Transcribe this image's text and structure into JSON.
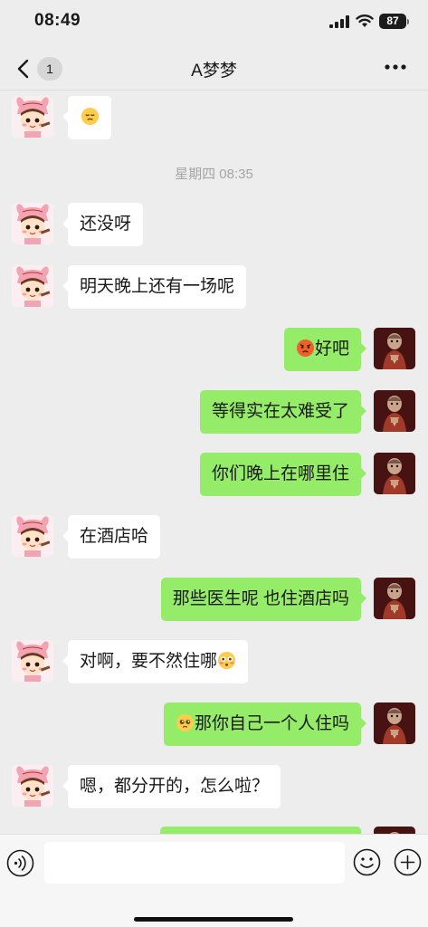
{
  "status_bar": {
    "time": "08:49",
    "battery": "87"
  },
  "nav": {
    "back_badge": "1",
    "title": "A梦梦"
  },
  "chat": {
    "timestamp": "星期四 08:35",
    "messages": [
      {
        "side": "left",
        "emoji_only": "sleepy-face-emoji"
      },
      {
        "side": "left",
        "text": "还没呀"
      },
      {
        "side": "left",
        "text": "明天晚上还有一场呢"
      },
      {
        "side": "right",
        "text": "好吧",
        "leading_emoji": "angry-face-emoji"
      },
      {
        "side": "right",
        "text": "等得实在太难受了"
      },
      {
        "side": "right",
        "text": "你们晚上在哪里住"
      },
      {
        "side": "left",
        "text": "在酒店哈"
      },
      {
        "side": "right",
        "text": "那些医生呢 也住酒店吗"
      },
      {
        "side": "left",
        "text": "对啊，要不然住哪",
        "trailing_emoji": "flushed-face-emoji"
      },
      {
        "side": "right",
        "text": "那你自己一个人住吗",
        "leading_emoji": "pleading-face-emoji"
      },
      {
        "side": "left",
        "text": "嗯，都分开的，怎么啦？"
      }
    ]
  },
  "colors": {
    "background": "#ededed",
    "bubble_right": "#95ec69",
    "bubble_left": "#ffffff",
    "timestamp": "#a5a5a5"
  },
  "icons": {
    "back": "chevron-left-icon",
    "more": "more-dots-icon",
    "voice": "voice-icon",
    "emoji": "emoji-icon",
    "plus": "plus-icon"
  }
}
